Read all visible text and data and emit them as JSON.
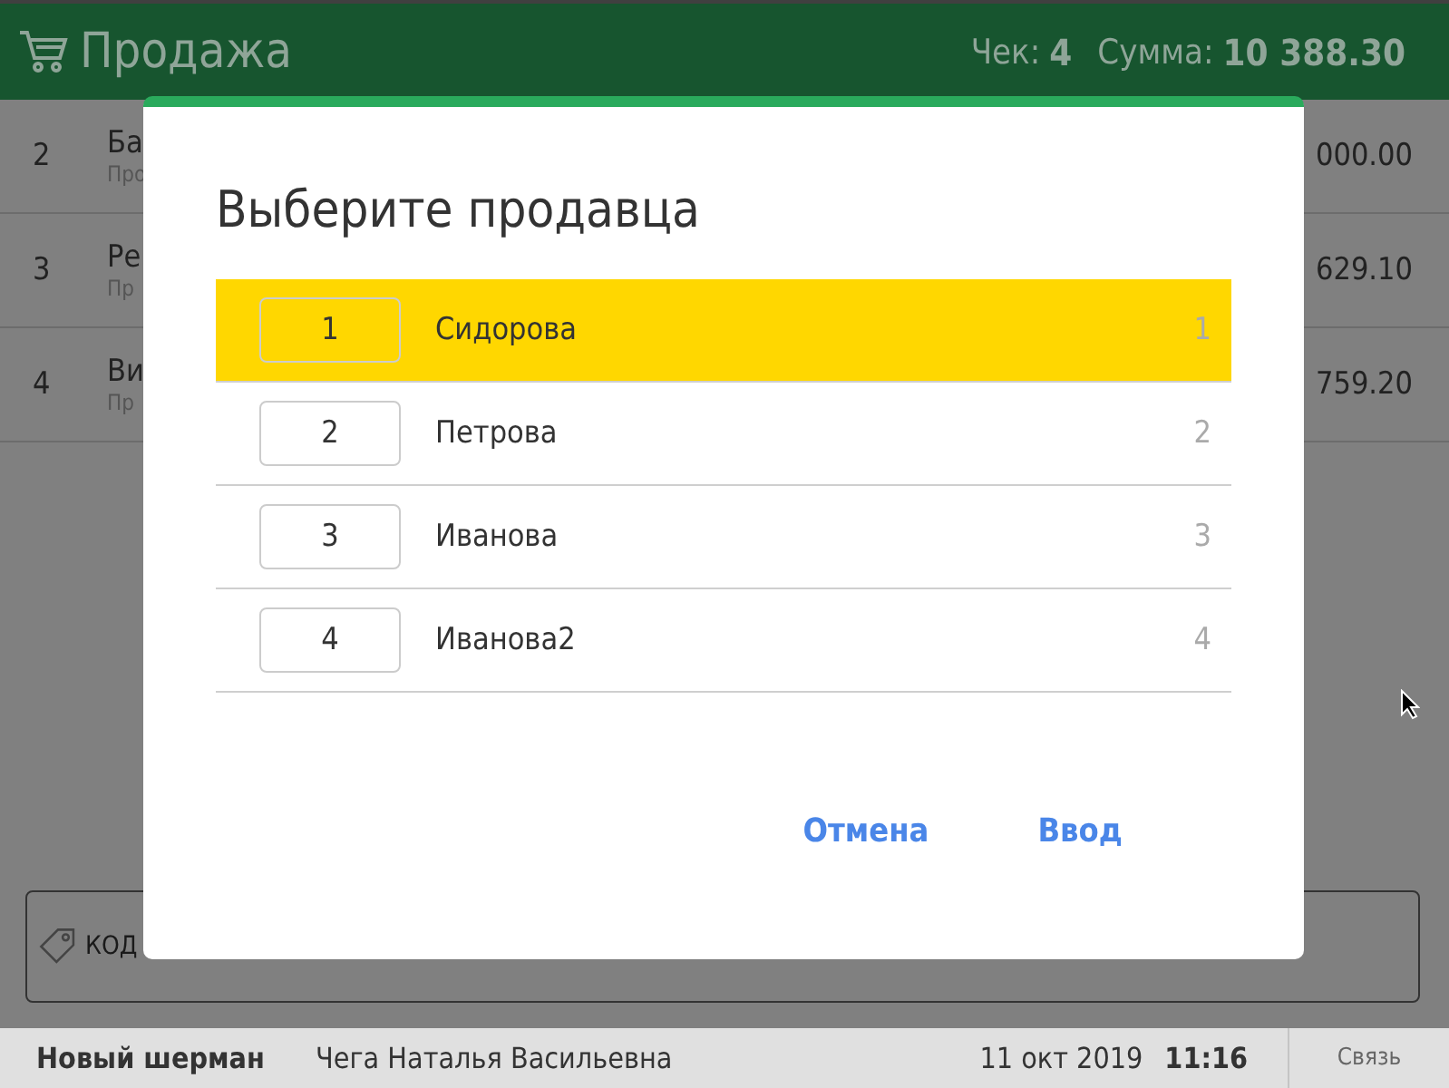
{
  "header": {
    "title": "Продажа",
    "check_label": "Чек:",
    "check_value": "4",
    "sum_label": "Сумма:",
    "sum_value": "10 388.30"
  },
  "receipt_rows": [
    {
      "number": "2",
      "name": "Ба",
      "subtitle": "Про",
      "amount": "000.00"
    },
    {
      "number": "3",
      "name": "Ре",
      "subtitle": "Пр",
      "amount": "629.10"
    },
    {
      "number": "4",
      "name": "Ви",
      "subtitle": "Пр",
      "amount": "759.20"
    }
  ],
  "code_field": {
    "placeholder": "КОД"
  },
  "dialog": {
    "title": "Выберите продавца",
    "sellers": [
      {
        "key": "1",
        "name": "Сидорова",
        "code": "1",
        "selected": true
      },
      {
        "key": "2",
        "name": "Петрова",
        "code": "2",
        "selected": false
      },
      {
        "key": "3",
        "name": "Иванова",
        "code": "3",
        "selected": false
      },
      {
        "key": "4",
        "name": "Иванова2",
        "code": "4",
        "selected": false
      }
    ],
    "buttons": [
      "Отмена",
      "Ввод"
    ]
  },
  "status_bar": {
    "shop": "Новый шерман",
    "cashier": "Чега Наталья Васильевна",
    "date": "11 окт 2019",
    "time": "11:16",
    "link": "Связь"
  }
}
